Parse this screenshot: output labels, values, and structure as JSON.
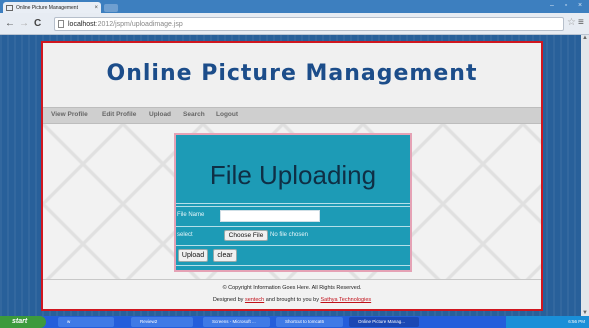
{
  "browser": {
    "tab_title": "Online Picture Management",
    "tab_close": "×",
    "url_host": "localhost",
    "url_path": ":2012/jspm/uploadimage.jsp",
    "back_icon": "back-arrow-icon",
    "forward_icon": "forward-arrow-icon",
    "reload_icon": "reload-icon"
  },
  "page": {
    "site_title": "Online Picture Management",
    "nav": [
      "View Profile",
      "Edit Profile",
      "Upload",
      "Search",
      "Logout"
    ],
    "form": {
      "heading": "File Uploading",
      "file_name_label": "File Name",
      "file_name_value": "",
      "select_label": "select",
      "choose_button": "Choose File",
      "no_file_text": "No file chosen",
      "upload_button": "Upload",
      "clear_button": "clear"
    },
    "footer": {
      "copyright": "© Copyright Information Goes Here. All Rights Reserved.",
      "designed_prefix": "Designed by",
      "designer": "sentech",
      "brought_text": "and brought to you by",
      "company": "Sathya Technologies"
    }
  },
  "taskbar": {
    "start": "start",
    "items": [
      "w",
      "Review2",
      "Screens - Microsoft ...",
      "Shortcut to tomcat6",
      "Online Picture Manag..."
    ],
    "clock": "6:56 PM"
  },
  "colors": {
    "title": "#1c4d8a",
    "frame_border": "#d0161f",
    "panel": "#1d9bb6",
    "panel_border": "#e5a2b5"
  }
}
